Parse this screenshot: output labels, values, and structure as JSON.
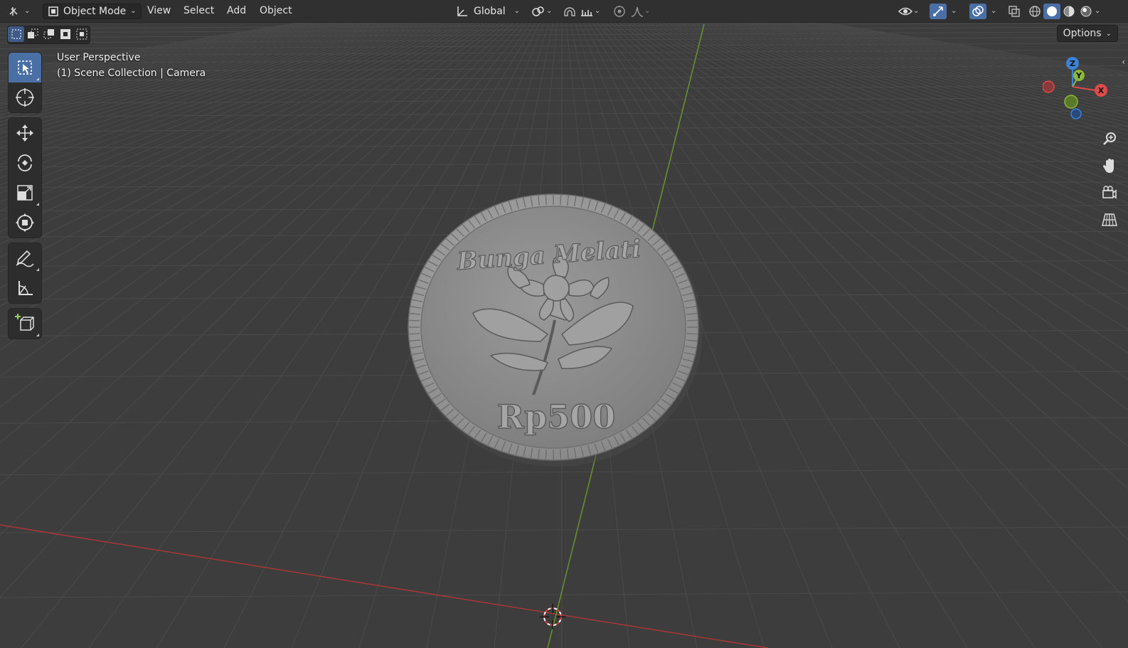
{
  "header": {
    "editor_type_icon": "editor-type-icon",
    "mode": "Object Mode",
    "menus": [
      "View",
      "Select",
      "Add",
      "Object"
    ],
    "transform_orientation": "Global",
    "options": "Options"
  },
  "viewport": {
    "view_name": "User Perspective",
    "collection": "(1) Scene Collection",
    "active_object": "Camera"
  },
  "toolbar": {
    "tools": [
      "select-box",
      "cursor",
      "move",
      "rotate",
      "scale",
      "transform",
      "annotate",
      "measure",
      "add-cube"
    ],
    "active": "select-box"
  },
  "gizmo": {
    "axes": [
      "Z",
      "Y",
      "X"
    ]
  },
  "coin": {
    "top_text": "Bunga Melati",
    "value_text": "Rp500"
  },
  "colors": {
    "background": "#3d3d3d",
    "header": "#303030",
    "grid_line": "#4a4a4a",
    "x_axis": "#c03a3a",
    "y_axis": "#6a9a2a",
    "active_tool": "#4a6fa5",
    "coin": "#8a8a8a",
    "gizmo_x": "#e04a4a",
    "gizmo_y": "#8ab83a",
    "gizmo_z": "#3a82d8"
  }
}
